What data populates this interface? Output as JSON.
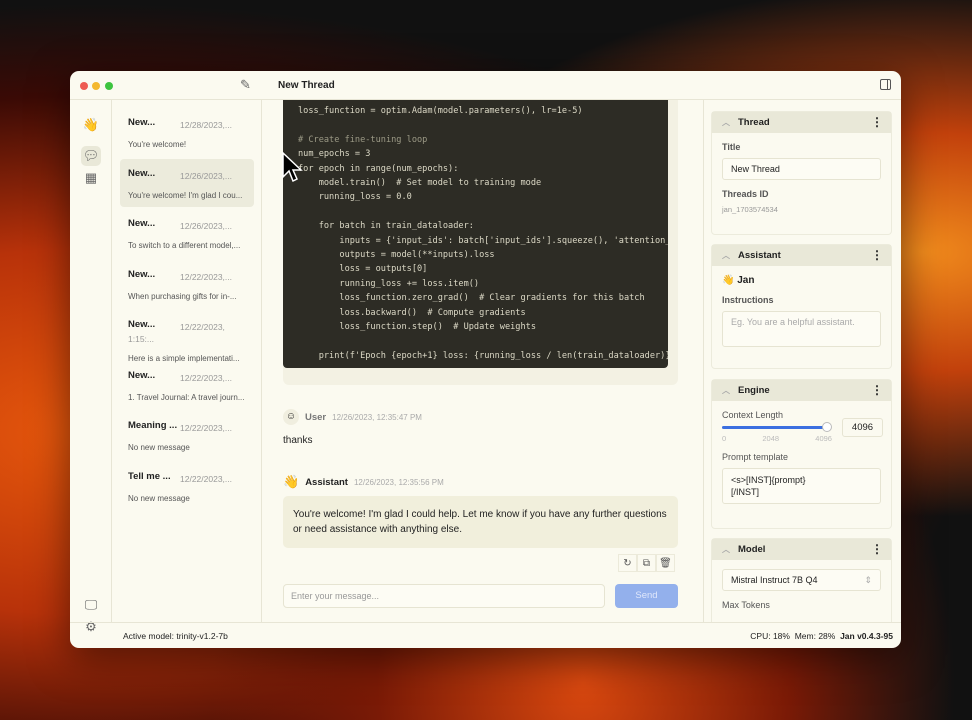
{
  "window": {
    "title": "New Thread"
  },
  "threads": [
    {
      "title": "New...",
      "date": "12/28/2023,...",
      "msg": "You're welcome!"
    },
    {
      "title": "New...",
      "date": "12/26/2023,...",
      "msg": "You're welcome! I'm glad I cou...",
      "selected": true
    },
    {
      "title": "New...",
      "date": "12/26/2023,...",
      "msg": "To switch to a different model,..."
    },
    {
      "title": "New...",
      "date": "12/22/2023,...",
      "msg": "When purchasing gifts for in-..."
    },
    {
      "title": "New...",
      "date": "12/22/2023, 1:15:...",
      "msg": "Here is a simple implementati..."
    },
    {
      "title": "New...",
      "date": "12/22/2023,...",
      "msg": "1. Travel Journal: A travel journ..."
    },
    {
      "title": "Meaning ...",
      "date": "12/22/2023,...",
      "msg": "No new message"
    },
    {
      "title": "Tell me ...",
      "date": "12/22/2023,...",
      "msg": "No new message"
    }
  ],
  "code": [
    "loss_function = optim.Adam(model.parameters(), lr=1e-5)",
    "",
    "# Create fine-tuning loop",
    "num_epochs = 3",
    "for epoch in range(num_epochs):",
    "    model.train()  # Set model to training mode",
    "    running_loss = 0.0",
    "",
    "    for batch in train_dataloader:",
    "        inputs = {'input_ids': batch['input_ids'].squeeze(), 'attention_mask'",
    "        outputs = model(**inputs).loss",
    "        loss = outputs[0]",
    "        running_loss += loss.item()",
    "        loss_function.zero_grad()  # Clear gradients for this batch",
    "        loss.backward()  # Compute gradients",
    "        loss_function.step()  # Update weights",
    "",
    "    print(f'Epoch {epoch+1} loss: {running_loss / len(train_dataloader)}')"
  ],
  "messages": {
    "user": {
      "name": "User",
      "time": "12/26/2023, 12:35:47 PM",
      "text": "thanks"
    },
    "assistant": {
      "name": "Assistant",
      "time": "12/26/2023, 12:35:56 PM",
      "text": "You're welcome! I'm glad I could help. Let me know if you have any further questions or need assistance with anything else."
    }
  },
  "composer": {
    "placeholder": "Enter your message...",
    "send": "Send"
  },
  "right": {
    "thread": {
      "header": "Thread",
      "title_label": "Title",
      "title_value": "New Thread",
      "id_label": "Threads ID",
      "id_value": "jan_1703574534"
    },
    "assistant": {
      "header": "Assistant",
      "name": "Jan",
      "instructions_label": "Instructions",
      "instructions_placeholder": "Eg. You are a helpful assistant."
    },
    "engine": {
      "header": "Engine",
      "context_label": "Context Length",
      "context_value": "4096",
      "context_fraction": 1.0,
      "ticks": [
        "0",
        "2048",
        "4096"
      ],
      "prompt_label": "Prompt template",
      "prompt_value": "<s>[INST]{prompt}\n[/INST]"
    },
    "model": {
      "header": "Model",
      "selected": "Mistral Instruct 7B Q4",
      "max_tokens_label": "Max Tokens"
    }
  },
  "status": {
    "active_model": "Active model: trinity-v1.2-7b",
    "cpu": "CPU: 18%",
    "mem": "Mem: 28%",
    "version": "Jan v0.4.3-95"
  },
  "colors": {
    "accent": "#3b6fe0",
    "send_disabled": "#93b0ec"
  }
}
